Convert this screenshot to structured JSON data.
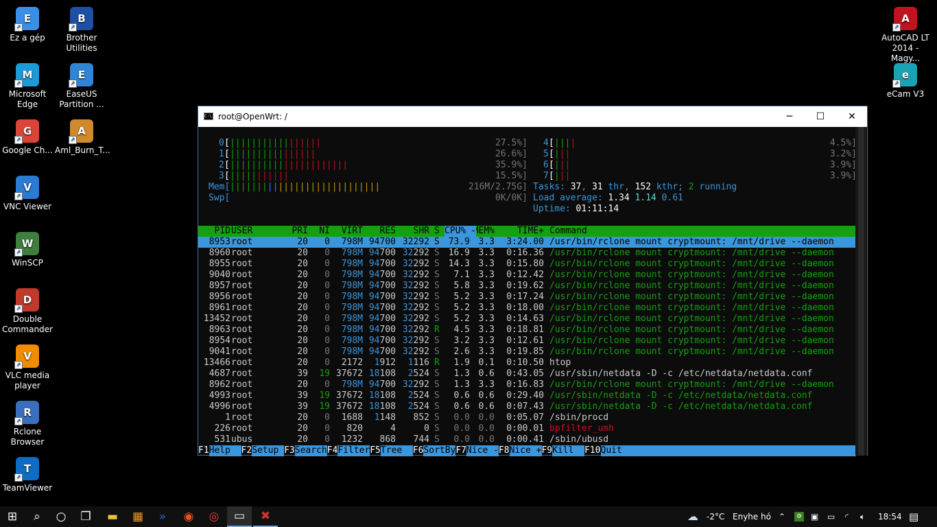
{
  "desktop": {
    "icons_left": [
      {
        "label": "Ez a gép",
        "icon": "computer-icon",
        "color": "#3a8ee6"
      },
      {
        "label": "Microsoft Edge",
        "icon": "edge-icon",
        "color": "#1c9bd8"
      },
      {
        "label": "Google Ch...",
        "icon": "chrome-icon",
        "color": "#db4437"
      },
      {
        "label": "VNC Viewer",
        "icon": "vnc-icon",
        "color": "#2a7bd1"
      },
      {
        "label": "WinSCP",
        "icon": "winscp-icon",
        "color": "#3f7e3f"
      },
      {
        "label": "Double Commander",
        "icon": "doublecmd-icon",
        "color": "#c0392b"
      },
      {
        "label": "VLC media player",
        "icon": "vlc-icon",
        "color": "#f08c00"
      },
      {
        "label": "Rclone Browser",
        "icon": "rclone-icon",
        "color": "#3a6fbf"
      },
      {
        "label": "TeamViewer",
        "icon": "teamviewer-icon",
        "color": "#0e6cc4"
      }
    ],
    "icons_col2": [
      {
        "label": "Brother Utilities",
        "icon": "brother-icon",
        "color": "#1d4fa3"
      },
      {
        "label": "EaseUS Partition ...",
        "icon": "easeus-icon",
        "color": "#2f86d6"
      },
      {
        "label": "Aml_Burn_T...",
        "icon": "amlburn-icon",
        "color": "#d08a2e"
      }
    ],
    "icons_right": [
      {
        "label": "AutoCAD LT 2014 - Magy...",
        "icon": "autocad-icon",
        "color": "#c1121f"
      },
      {
        "label": "eCam V3",
        "icon": "ecam-icon",
        "color": "#19a3b5"
      }
    ]
  },
  "window": {
    "title": "root@OpenWrt: /",
    "minimize": "─",
    "maximize": "☐",
    "close": "✕"
  },
  "htop": {
    "cpus": [
      {
        "id": "0",
        "pct": "27.5%]",
        "green": 11,
        "red": 6
      },
      {
        "id": "1",
        "pct": "26.6%]",
        "green": 10,
        "red": 6
      },
      {
        "id": "2",
        "pct": "35.9%]",
        "green": 10,
        "red": 12
      },
      {
        "id": "3",
        "pct": "15.5%]",
        "green": 5,
        "red": 6
      },
      {
        "id": "4",
        "pct": "4.5%]",
        "green": 3,
        "red": 1
      },
      {
        "id": "5",
        "pct": "3.2%]",
        "green": 1,
        "red": 2
      },
      {
        "id": "6",
        "pct": "3.9%]",
        "green": 1,
        "red": 2
      },
      {
        "id": "7",
        "pct": "3.9%]",
        "green": 1,
        "red": 2
      }
    ],
    "mem": {
      "label": "Mem[",
      "value": "216M/2.75G]",
      "green": 7,
      "blue": 2,
      "yellow": 19
    },
    "swp": {
      "label": "Swp[",
      "value": "0K/0K]"
    },
    "tasks": {
      "label": "Tasks:",
      "procs": "37",
      "thr": "31",
      "thr_label": "thr,",
      "kthr": "152",
      "kthr_label": "kthr;",
      "running": "2",
      "running_label": "running"
    },
    "load": {
      "label": "Load average:",
      "v1": "1.34",
      "v2": "1.14",
      "v3": "0.61"
    },
    "uptime": {
      "label": "Uptime:",
      "value": "01:11:14"
    },
    "header": [
      "PID",
      "USER",
      "PRI",
      "NI",
      "VIRT",
      "RES",
      "SHR",
      "S",
      "CPU%",
      "MEM%",
      "TIME+",
      "Command"
    ],
    "sort_indicator": "-",
    "processes": [
      {
        "pid": "8953",
        "user": "root",
        "pri": "20",
        "ni": "0",
        "virt": "798M",
        "res": "94700",
        "shr": "32292",
        "s": "S",
        "cpu": "73.9",
        "mem": "3.3",
        "time": "3:24.00",
        "cmd": "/usr/bin/rclone mount cryptmount: /mnt/drive --daemon",
        "kind": "sel"
      },
      {
        "pid": "8960",
        "user": "root",
        "pri": "20",
        "ni": "0",
        "virt": "798M",
        "res": "94700",
        "shr": "32292",
        "s": "S",
        "cpu": "16.9",
        "mem": "3.3",
        "time": "0:16.36",
        "cmd": "/usr/bin/rclone mount cryptmount: /mnt/drive --daemon",
        "kind": "thread"
      },
      {
        "pid": "8955",
        "user": "root",
        "pri": "20",
        "ni": "0",
        "virt": "798M",
        "res": "94700",
        "shr": "32292",
        "s": "S",
        "cpu": "14.3",
        "mem": "3.3",
        "time": "0:15.80",
        "cmd": "/usr/bin/rclone mount cryptmount: /mnt/drive --daemon",
        "kind": "thread"
      },
      {
        "pid": "9040",
        "user": "root",
        "pri": "20",
        "ni": "0",
        "virt": "798M",
        "res": "94700",
        "shr": "32292",
        "s": "S",
        "cpu": "7.1",
        "mem": "3.3",
        "time": "0:12.42",
        "cmd": "/usr/bin/rclone mount cryptmount: /mnt/drive --daemon",
        "kind": "thread"
      },
      {
        "pid": "8957",
        "user": "root",
        "pri": "20",
        "ni": "0",
        "virt": "798M",
        "res": "94700",
        "shr": "32292",
        "s": "S",
        "cpu": "5.8",
        "mem": "3.3",
        "time": "0:19.62",
        "cmd": "/usr/bin/rclone mount cryptmount: /mnt/drive --daemon",
        "kind": "thread"
      },
      {
        "pid": "8956",
        "user": "root",
        "pri": "20",
        "ni": "0",
        "virt": "798M",
        "res": "94700",
        "shr": "32292",
        "s": "S",
        "cpu": "5.2",
        "mem": "3.3",
        "time": "0:17.24",
        "cmd": "/usr/bin/rclone mount cryptmount: /mnt/drive --daemon",
        "kind": "thread"
      },
      {
        "pid": "8961",
        "user": "root",
        "pri": "20",
        "ni": "0",
        "virt": "798M",
        "res": "94700",
        "shr": "32292",
        "s": "S",
        "cpu": "5.2",
        "mem": "3.3",
        "time": "0:18.00",
        "cmd": "/usr/bin/rclone mount cryptmount: /mnt/drive --daemon",
        "kind": "thread"
      },
      {
        "pid": "13452",
        "user": "root",
        "pri": "20",
        "ni": "0",
        "virt": "798M",
        "res": "94700",
        "shr": "32292",
        "s": "S",
        "cpu": "5.2",
        "mem": "3.3",
        "time": "0:14.63",
        "cmd": "/usr/bin/rclone mount cryptmount: /mnt/drive --daemon",
        "kind": "thread"
      },
      {
        "pid": "8963",
        "user": "root",
        "pri": "20",
        "ni": "0",
        "virt": "798M",
        "res": "94700",
        "shr": "32292",
        "s": "R",
        "cpu": "4.5",
        "mem": "3.3",
        "time": "0:18.81",
        "cmd": "/usr/bin/rclone mount cryptmount: /mnt/drive --daemon",
        "kind": "thread"
      },
      {
        "pid": "8954",
        "user": "root",
        "pri": "20",
        "ni": "0",
        "virt": "798M",
        "res": "94700",
        "shr": "32292",
        "s": "S",
        "cpu": "3.2",
        "mem": "3.3",
        "time": "0:12.61",
        "cmd": "/usr/bin/rclone mount cryptmount: /mnt/drive --daemon",
        "kind": "thread"
      },
      {
        "pid": "9041",
        "user": "root",
        "pri": "20",
        "ni": "0",
        "virt": "798M",
        "res": "94700",
        "shr": "32292",
        "s": "S",
        "cpu": "2.6",
        "mem": "3.3",
        "time": "0:19.85",
        "cmd": "/usr/bin/rclone mount cryptmount: /mnt/drive --daemon",
        "kind": "thread"
      },
      {
        "pid": "13466",
        "user": "root",
        "pri": "20",
        "ni": "0",
        "virt": "2172",
        "res": "1912",
        "shr": "1116",
        "s": "R",
        "cpu": "1.9",
        "mem": "0.1",
        "time": "0:10.50",
        "cmd": "htop",
        "kind": "proc"
      },
      {
        "pid": "4687",
        "user": "root",
        "pri": "39",
        "ni": "19",
        "virt": "37672",
        "res": "18108",
        "shr": "2524",
        "s": "S",
        "cpu": "1.3",
        "mem": "0.6",
        "time": "0:43.05",
        "cmd": "/usr/sbin/netdata -D -c /etc/netdata/netdata.conf",
        "kind": "proc"
      },
      {
        "pid": "8962",
        "user": "root",
        "pri": "20",
        "ni": "0",
        "virt": "798M",
        "res": "94700",
        "shr": "32292",
        "s": "S",
        "cpu": "1.3",
        "mem": "3.3",
        "time": "0:16.83",
        "cmd": "/usr/bin/rclone mount cryptmount: /mnt/drive --daemon",
        "kind": "thread"
      },
      {
        "pid": "4993",
        "user": "root",
        "pri": "39",
        "ni": "19",
        "virt": "37672",
        "res": "18108",
        "shr": "2524",
        "s": "S",
        "cpu": "0.6",
        "mem": "0.6",
        "time": "0:29.40",
        "cmd": "/usr/sbin/netdata -D -c /etc/netdata/netdata.conf",
        "kind": "thread"
      },
      {
        "pid": "4996",
        "user": "root",
        "pri": "39",
        "ni": "19",
        "virt": "37672",
        "res": "18108",
        "shr": "2524",
        "s": "S",
        "cpu": "0.6",
        "mem": "0.6",
        "time": "0:07.43",
        "cmd": "/usr/sbin/netdata -D -c /etc/netdata/netdata.conf",
        "kind": "thread"
      },
      {
        "pid": "1",
        "user": "root",
        "pri": "20",
        "ni": "0",
        "virt": "1688",
        "res": "1148",
        "shr": "852",
        "s": "S",
        "cpu": "0.0",
        "mem": "0.0",
        "time": "0:05.07",
        "cmd": "/sbin/procd",
        "kind": "proc"
      },
      {
        "pid": "226",
        "user": "root",
        "pri": "20",
        "ni": "0",
        "virt": "820",
        "res": "4",
        "shr": "0",
        "s": "S",
        "cpu": "0.0",
        "mem": "0.0",
        "time": "0:00.01",
        "cmd": "bpfilter_umh",
        "kind": "kernel"
      },
      {
        "pid": "531",
        "user": "ubus",
        "pri": "20",
        "ni": "0",
        "virt": "1232",
        "res": "868",
        "shr": "744",
        "s": "S",
        "cpu": "0.0",
        "mem": "0.0",
        "time": "0:00.41",
        "cmd": "/sbin/ubusd",
        "kind": "proc"
      }
    ],
    "fkeys": [
      {
        "key": "F1",
        "label": "Help  "
      },
      {
        "key": "F2",
        "label": "Setup "
      },
      {
        "key": "F3",
        "label": "Search"
      },
      {
        "key": "F4",
        "label": "Filter"
      },
      {
        "key": "F5",
        "label": "Tree  "
      },
      {
        "key": "F6",
        "label": "SortBy"
      },
      {
        "key": "F7",
        "label": "Nice -"
      },
      {
        "key": "F8",
        "label": "Nice +"
      },
      {
        "key": "F9",
        "label": "Kill  "
      },
      {
        "key": "F10",
        "label": "Quit  "
      }
    ]
  },
  "taskbar": {
    "weather_temp": "-2°C",
    "weather_text": "Enyhe hó",
    "clock": "18:54",
    "apps": [
      "start-icon",
      "search-icon",
      "cortana-icon",
      "taskview-icon",
      "explorer-icon",
      "store-icon",
      "powershell-icon",
      "ubuntu-icon",
      "chrome-icon",
      "cmd-icon",
      "doublecmd-icon"
    ]
  }
}
